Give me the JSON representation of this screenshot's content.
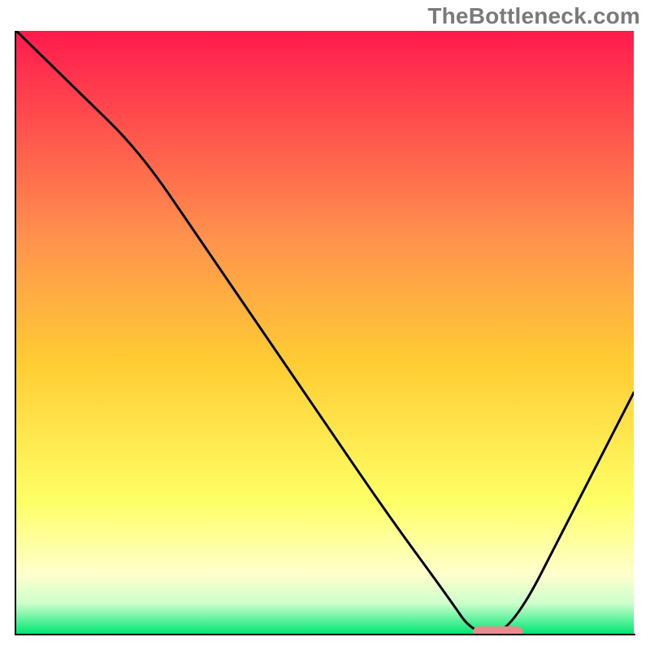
{
  "watermark": "TheBottleneck.com",
  "colors": {
    "gradient_top": "#ff1a4d",
    "gradient_upper_mid": "#ff944d",
    "gradient_mid": "#ffcc33",
    "gradient_lower_mid": "#ffff66",
    "gradient_light_yellow": "#ffffcc",
    "gradient_pale_green": "#ccffcc",
    "gradient_bottom": "#00e673",
    "curve": "#000000",
    "marker": "#e98b8f",
    "frame": "#000000"
  },
  "chart_data": {
    "type": "line",
    "title": "",
    "xlabel": "",
    "ylabel": "",
    "xlim": [
      0,
      100
    ],
    "ylim": [
      0,
      100
    ],
    "grid": false,
    "legend": false,
    "background_gradient": {
      "direction": "vertical",
      "stops": [
        {
          "offset": 0.0,
          "color": "#ff1a4d"
        },
        {
          "offset": 0.35,
          "color": "#ff944d"
        },
        {
          "offset": 0.55,
          "color": "#ffcc33"
        },
        {
          "offset": 0.78,
          "color": "#ffff66"
        },
        {
          "offset": 0.9,
          "color": "#ffffcc"
        },
        {
          "offset": 0.95,
          "color": "#ccffcc"
        },
        {
          "offset": 1.0,
          "color": "#00e673"
        }
      ]
    },
    "series": [
      {
        "name": "bottleneck-curve",
        "x": [
          0,
          10,
          20,
          30,
          40,
          50,
          60,
          70,
          74,
          80,
          90,
          100
        ],
        "y": [
          100,
          90,
          80,
          65,
          50,
          35,
          20,
          6,
          0,
          0,
          20,
          40
        ]
      }
    ],
    "marker": {
      "name": "optimal-range",
      "x_start": 74,
      "x_end": 82,
      "y": 0
    }
  }
}
